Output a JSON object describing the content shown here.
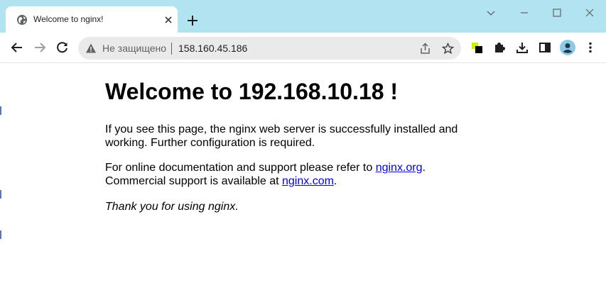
{
  "tab": {
    "title": "Welcome to nginx!"
  },
  "omnibox": {
    "security_label": "Не защищено",
    "url": "158.160.45.186"
  },
  "page": {
    "heading": "Welcome to 192.168.10.18 !",
    "para1": "If you see this page, the nginx web server is successfully installed and working. Further configuration is required.",
    "para2_prefix": "For online documentation and support please refer to ",
    "link1": "nginx.org",
    "para2_mid": ".",
    "para2_line2_prefix": "Commercial support is available at ",
    "link2": "nginx.com",
    "para2_suffix": ".",
    "para3": "Thank you for using nginx."
  },
  "colors": {
    "titlebar_bg": "#b2e3f0",
    "link": "#0000ee",
    "omnibox_bg": "#eaeaea",
    "avatar_bg": "#8ecae6"
  },
  "icons": {
    "tab_favicon": "globe-icon",
    "tab_close": "close-icon",
    "new_tab": "plus-icon",
    "window_controls": [
      "chevron-down-icon",
      "minimize-icon",
      "maximize-icon",
      "close-window-icon"
    ],
    "nav": [
      "back-arrow-icon",
      "forward-arrow-icon",
      "reload-icon"
    ],
    "omnibox": [
      "warning-icon",
      "share-icon",
      "bookmark-star-icon"
    ],
    "toolbar": [
      "extension-color-icon",
      "puzzle-icon",
      "download-icon",
      "side-panel-icon",
      "profile-avatar-icon",
      "menu-dots-icon"
    ]
  }
}
